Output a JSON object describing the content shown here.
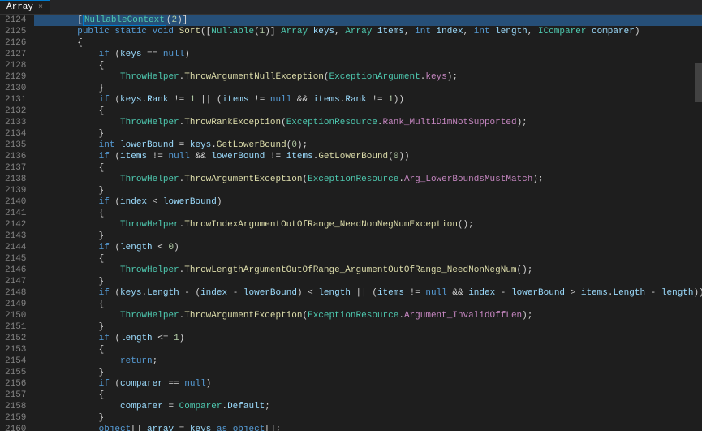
{
  "tab": {
    "label": "Array",
    "close": "×"
  },
  "lines": [
    {
      "n": 2124,
      "hl": true,
      "tokens": [
        {
          "t": "        ",
          "c": "plain"
        },
        {
          "t": "[",
          "c": "paren"
        },
        {
          "t": "NullableContext",
          "c": "type",
          "box": true
        },
        {
          "t": "(",
          "c": "paren"
        },
        {
          "t": "2",
          "c": "num"
        },
        {
          "t": ")]",
          "c": "paren"
        }
      ]
    },
    {
      "n": 2125,
      "tokens": [
        {
          "t": "        ",
          "c": "plain"
        },
        {
          "t": "public static void ",
          "c": "keyword"
        },
        {
          "t": "Sort",
          "c": "method"
        },
        {
          "t": "([",
          "c": "paren"
        },
        {
          "t": "Nullable",
          "c": "type"
        },
        {
          "t": "(",
          "c": "paren"
        },
        {
          "t": "1",
          "c": "num"
        },
        {
          "t": ")] ",
          "c": "paren"
        },
        {
          "t": "Array ",
          "c": "type"
        },
        {
          "t": "keys",
          "c": "param"
        },
        {
          "t": ", ",
          "c": "plain"
        },
        {
          "t": "Array ",
          "c": "type"
        },
        {
          "t": "items",
          "c": "param"
        },
        {
          "t": ", ",
          "c": "plain"
        },
        {
          "t": "int ",
          "c": "keyword"
        },
        {
          "t": "index",
          "c": "param"
        },
        {
          "t": ", ",
          "c": "plain"
        },
        {
          "t": "int ",
          "c": "keyword"
        },
        {
          "t": "length",
          "c": "param"
        },
        {
          "t": ", ",
          "c": "plain"
        },
        {
          "t": "IComparer ",
          "c": "type"
        },
        {
          "t": "comparer",
          "c": "param"
        },
        {
          "t": ")",
          "c": "paren"
        }
      ]
    },
    {
      "n": 2126,
      "tokens": [
        {
          "t": "        {",
          "c": "plain"
        }
      ]
    },
    {
      "n": 2127,
      "tokens": [
        {
          "t": "            ",
          "c": "plain"
        },
        {
          "t": "if ",
          "c": "keyword"
        },
        {
          "t": "(",
          "c": "paren"
        },
        {
          "t": "keys",
          "c": "param"
        },
        {
          "t": " == ",
          "c": "op"
        },
        {
          "t": "null",
          "c": "keyword"
        },
        {
          "t": ")",
          "c": "paren"
        }
      ]
    },
    {
      "n": 2128,
      "tokens": [
        {
          "t": "            {",
          "c": "plain"
        }
      ]
    },
    {
      "n": 2129,
      "tokens": [
        {
          "t": "                ",
          "c": "plain"
        },
        {
          "t": "ThrowHelper",
          "c": "type"
        },
        {
          "t": ".",
          "c": "plain"
        },
        {
          "t": "ThrowArgumentNullException",
          "c": "method"
        },
        {
          "t": "(",
          "c": "paren"
        },
        {
          "t": "ExceptionArgument",
          "c": "type"
        },
        {
          "t": ".",
          "c": "plain"
        },
        {
          "t": "keys",
          "c": "enum"
        },
        {
          "t": ");",
          "c": "paren"
        }
      ]
    },
    {
      "n": 2130,
      "tokens": [
        {
          "t": "            }",
          "c": "plain"
        }
      ]
    },
    {
      "n": 2131,
      "tokens": [
        {
          "t": "            ",
          "c": "plain"
        },
        {
          "t": "if ",
          "c": "keyword"
        },
        {
          "t": "(",
          "c": "paren"
        },
        {
          "t": "keys",
          "c": "param"
        },
        {
          "t": ".",
          "c": "plain"
        },
        {
          "t": "Rank",
          "c": "field"
        },
        {
          "t": " != ",
          "c": "op"
        },
        {
          "t": "1",
          "c": "num"
        },
        {
          "t": " || (",
          "c": "op"
        },
        {
          "t": "items",
          "c": "param"
        },
        {
          "t": " != ",
          "c": "op"
        },
        {
          "t": "null",
          "c": "keyword"
        },
        {
          "t": " && ",
          "c": "op"
        },
        {
          "t": "items",
          "c": "param"
        },
        {
          "t": ".",
          "c": "plain"
        },
        {
          "t": "Rank",
          "c": "field"
        },
        {
          "t": " != ",
          "c": "op"
        },
        {
          "t": "1",
          "c": "num"
        },
        {
          "t": "))",
          "c": "paren"
        }
      ]
    },
    {
      "n": 2132,
      "tokens": [
        {
          "t": "            {",
          "c": "plain"
        }
      ]
    },
    {
      "n": 2133,
      "tokens": [
        {
          "t": "                ",
          "c": "plain"
        },
        {
          "t": "ThrowHelper",
          "c": "type"
        },
        {
          "t": ".",
          "c": "plain"
        },
        {
          "t": "ThrowRankException",
          "c": "method"
        },
        {
          "t": "(",
          "c": "paren"
        },
        {
          "t": "ExceptionResource",
          "c": "type"
        },
        {
          "t": ".",
          "c": "plain"
        },
        {
          "t": "Rank_MultiDimNotSupported",
          "c": "enum"
        },
        {
          "t": ");",
          "c": "paren"
        }
      ]
    },
    {
      "n": 2134,
      "tokens": [
        {
          "t": "            }",
          "c": "plain"
        }
      ]
    },
    {
      "n": 2135,
      "tokens": [
        {
          "t": "            ",
          "c": "plain"
        },
        {
          "t": "int ",
          "c": "keyword"
        },
        {
          "t": "lowerBound",
          "c": "var"
        },
        {
          "t": " = ",
          "c": "op"
        },
        {
          "t": "keys",
          "c": "param"
        },
        {
          "t": ".",
          "c": "plain"
        },
        {
          "t": "GetLowerBound",
          "c": "method"
        },
        {
          "t": "(",
          "c": "paren"
        },
        {
          "t": "0",
          "c": "num"
        },
        {
          "t": ");",
          "c": "paren"
        }
      ]
    },
    {
      "n": 2136,
      "tokens": [
        {
          "t": "            ",
          "c": "plain"
        },
        {
          "t": "if ",
          "c": "keyword"
        },
        {
          "t": "(",
          "c": "paren"
        },
        {
          "t": "items",
          "c": "param"
        },
        {
          "t": " != ",
          "c": "op"
        },
        {
          "t": "null",
          "c": "keyword"
        },
        {
          "t": " && ",
          "c": "op"
        },
        {
          "t": "lowerBound",
          "c": "var"
        },
        {
          "t": " != ",
          "c": "op"
        },
        {
          "t": "items",
          "c": "param"
        },
        {
          "t": ".",
          "c": "plain"
        },
        {
          "t": "GetLowerBound",
          "c": "method"
        },
        {
          "t": "(",
          "c": "paren"
        },
        {
          "t": "0",
          "c": "num"
        },
        {
          "t": "))",
          "c": "paren"
        }
      ]
    },
    {
      "n": 2137,
      "tokens": [
        {
          "t": "            {",
          "c": "plain"
        }
      ]
    },
    {
      "n": 2138,
      "tokens": [
        {
          "t": "                ",
          "c": "plain"
        },
        {
          "t": "ThrowHelper",
          "c": "type"
        },
        {
          "t": ".",
          "c": "plain"
        },
        {
          "t": "ThrowArgumentException",
          "c": "method"
        },
        {
          "t": "(",
          "c": "paren"
        },
        {
          "t": "ExceptionResource",
          "c": "type"
        },
        {
          "t": ".",
          "c": "plain"
        },
        {
          "t": "Arg_LowerBoundsMustMatch",
          "c": "enum"
        },
        {
          "t": ");",
          "c": "paren"
        }
      ]
    },
    {
      "n": 2139,
      "tokens": [
        {
          "t": "            }",
          "c": "plain"
        }
      ]
    },
    {
      "n": 2140,
      "tokens": [
        {
          "t": "            ",
          "c": "plain"
        },
        {
          "t": "if ",
          "c": "keyword"
        },
        {
          "t": "(",
          "c": "paren"
        },
        {
          "t": "index",
          "c": "param"
        },
        {
          "t": " < ",
          "c": "op"
        },
        {
          "t": "lowerBound",
          "c": "var"
        },
        {
          "t": ")",
          "c": "paren"
        }
      ]
    },
    {
      "n": 2141,
      "tokens": [
        {
          "t": "            {",
          "c": "plain"
        }
      ]
    },
    {
      "n": 2142,
      "tokens": [
        {
          "t": "                ",
          "c": "plain"
        },
        {
          "t": "ThrowHelper",
          "c": "type"
        },
        {
          "t": ".",
          "c": "plain"
        },
        {
          "t": "ThrowIndexArgumentOutOfRange_NeedNonNegNumException",
          "c": "method"
        },
        {
          "t": "();",
          "c": "paren"
        }
      ]
    },
    {
      "n": 2143,
      "tokens": [
        {
          "t": "            }",
          "c": "plain"
        }
      ]
    },
    {
      "n": 2144,
      "tokens": [
        {
          "t": "            ",
          "c": "plain"
        },
        {
          "t": "if ",
          "c": "keyword"
        },
        {
          "t": "(",
          "c": "paren"
        },
        {
          "t": "length",
          "c": "param"
        },
        {
          "t": " < ",
          "c": "op"
        },
        {
          "t": "0",
          "c": "num"
        },
        {
          "t": ")",
          "c": "paren"
        }
      ]
    },
    {
      "n": 2145,
      "tokens": [
        {
          "t": "            {",
          "c": "plain"
        }
      ]
    },
    {
      "n": 2146,
      "tokens": [
        {
          "t": "                ",
          "c": "plain"
        },
        {
          "t": "ThrowHelper",
          "c": "type"
        },
        {
          "t": ".",
          "c": "plain"
        },
        {
          "t": "ThrowLengthArgumentOutOfRange_ArgumentOutOfRange_NeedNonNegNum",
          "c": "method"
        },
        {
          "t": "();",
          "c": "paren"
        }
      ]
    },
    {
      "n": 2147,
      "tokens": [
        {
          "t": "            }",
          "c": "plain"
        }
      ]
    },
    {
      "n": 2148,
      "tokens": [
        {
          "t": "            ",
          "c": "plain"
        },
        {
          "t": "if ",
          "c": "keyword"
        },
        {
          "t": "(",
          "c": "paren"
        },
        {
          "t": "keys",
          "c": "param"
        },
        {
          "t": ".",
          "c": "plain"
        },
        {
          "t": "Length",
          "c": "field"
        },
        {
          "t": " - (",
          "c": "op"
        },
        {
          "t": "index",
          "c": "param"
        },
        {
          "t": " - ",
          "c": "op"
        },
        {
          "t": "lowerBound",
          "c": "var"
        },
        {
          "t": ") < ",
          "c": "op"
        },
        {
          "t": "length",
          "c": "param"
        },
        {
          "t": " || (",
          "c": "op"
        },
        {
          "t": "items",
          "c": "param"
        },
        {
          "t": " != ",
          "c": "op"
        },
        {
          "t": "null",
          "c": "keyword"
        },
        {
          "t": " && ",
          "c": "op"
        },
        {
          "t": "index",
          "c": "param"
        },
        {
          "t": " - ",
          "c": "op"
        },
        {
          "t": "lowerBound",
          "c": "var"
        },
        {
          "t": " > ",
          "c": "op"
        },
        {
          "t": "items",
          "c": "param"
        },
        {
          "t": ".",
          "c": "plain"
        },
        {
          "t": "Length",
          "c": "field"
        },
        {
          "t": " - ",
          "c": "op"
        },
        {
          "t": "length",
          "c": "param"
        },
        {
          "t": "))",
          "c": "paren"
        }
      ]
    },
    {
      "n": 2149,
      "tokens": [
        {
          "t": "            {",
          "c": "plain"
        }
      ]
    },
    {
      "n": 2150,
      "tokens": [
        {
          "t": "                ",
          "c": "plain"
        },
        {
          "t": "ThrowHelper",
          "c": "type"
        },
        {
          "t": ".",
          "c": "plain"
        },
        {
          "t": "ThrowArgumentException",
          "c": "method"
        },
        {
          "t": "(",
          "c": "paren"
        },
        {
          "t": "ExceptionResource",
          "c": "type"
        },
        {
          "t": ".",
          "c": "plain"
        },
        {
          "t": "Argument_InvalidOffLen",
          "c": "enum"
        },
        {
          "t": ");",
          "c": "paren"
        }
      ]
    },
    {
      "n": 2151,
      "tokens": [
        {
          "t": "            }",
          "c": "plain"
        }
      ]
    },
    {
      "n": 2152,
      "tokens": [
        {
          "t": "            ",
          "c": "plain"
        },
        {
          "t": "if ",
          "c": "keyword"
        },
        {
          "t": "(",
          "c": "paren"
        },
        {
          "t": "length",
          "c": "param"
        },
        {
          "t": " <= ",
          "c": "op"
        },
        {
          "t": "1",
          "c": "num"
        },
        {
          "t": ")",
          "c": "paren"
        }
      ]
    },
    {
      "n": 2153,
      "tokens": [
        {
          "t": "            {",
          "c": "plain"
        }
      ]
    },
    {
      "n": 2154,
      "tokens": [
        {
          "t": "                ",
          "c": "plain"
        },
        {
          "t": "return",
          "c": "keyword"
        },
        {
          "t": ";",
          "c": "plain"
        }
      ]
    },
    {
      "n": 2155,
      "tokens": [
        {
          "t": "            }",
          "c": "plain"
        }
      ]
    },
    {
      "n": 2156,
      "tokens": [
        {
          "t": "            ",
          "c": "plain"
        },
        {
          "t": "if ",
          "c": "keyword"
        },
        {
          "t": "(",
          "c": "paren"
        },
        {
          "t": "comparer",
          "c": "param"
        },
        {
          "t": " == ",
          "c": "op"
        },
        {
          "t": "null",
          "c": "keyword"
        },
        {
          "t": ")",
          "c": "paren"
        }
      ]
    },
    {
      "n": 2157,
      "tokens": [
        {
          "t": "            {",
          "c": "plain"
        }
      ]
    },
    {
      "n": 2158,
      "tokens": [
        {
          "t": "                ",
          "c": "plain"
        },
        {
          "t": "comparer",
          "c": "param"
        },
        {
          "t": " = ",
          "c": "op"
        },
        {
          "t": "Comparer",
          "c": "type"
        },
        {
          "t": ".",
          "c": "plain"
        },
        {
          "t": "Default",
          "c": "field"
        },
        {
          "t": ";",
          "c": "plain"
        }
      ]
    },
    {
      "n": 2159,
      "tokens": [
        {
          "t": "            }",
          "c": "plain"
        }
      ]
    },
    {
      "n": 2160,
      "tokens": [
        {
          "t": "            ",
          "c": "plain"
        },
        {
          "t": "object",
          "c": "keyword"
        },
        {
          "t": "[] ",
          "c": "plain"
        },
        {
          "t": "array",
          "c": "var"
        },
        {
          "t": " = ",
          "c": "op"
        },
        {
          "t": "keys",
          "c": "param"
        },
        {
          "t": " as ",
          "c": "keyword"
        },
        {
          "t": "object",
          "c": "keyword"
        },
        {
          "t": "[];",
          "c": "plain"
        }
      ]
    }
  ]
}
